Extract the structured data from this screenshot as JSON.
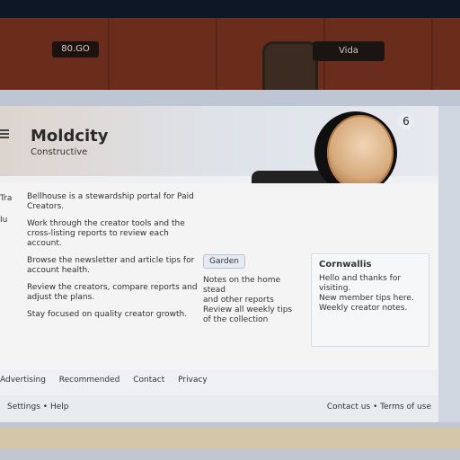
{
  "shelf": {
    "left_label": "80.GO",
    "right_label": "Vida"
  },
  "header": {
    "brand_title": "Moldcity",
    "brand_subtitle": "Constructive",
    "profile_badge": "6"
  },
  "left_rail": [
    "Tra",
    "Iu"
  ],
  "content": {
    "paragraphs": [
      "Bellhouse is a stewardship portal for Paid Creators.",
      "Work through the creator tools and the cross-listing reports to review each account.",
      "Browse the newsletter and article tips for account health.",
      "Review the creators, compare reports and adjust the plans.",
      "Stay focused on quality creator growth."
    ],
    "mid_pill": "Garden",
    "mid_lines": [
      "Notes on the home stead",
      "and other reports",
      "Review all weekly tips",
      "of the collection"
    ],
    "panel_title": "Cornwallis",
    "panel_lines": [
      "Hello and thanks for visiting.",
      "New member tips here.",
      "Weekly creator notes."
    ]
  },
  "bottom_links": [
    "Advertising",
    "Recommended",
    "Contact",
    "Privacy"
  ],
  "footer": {
    "left": "Settings • Help",
    "right": "Contact us • Terms of use"
  }
}
